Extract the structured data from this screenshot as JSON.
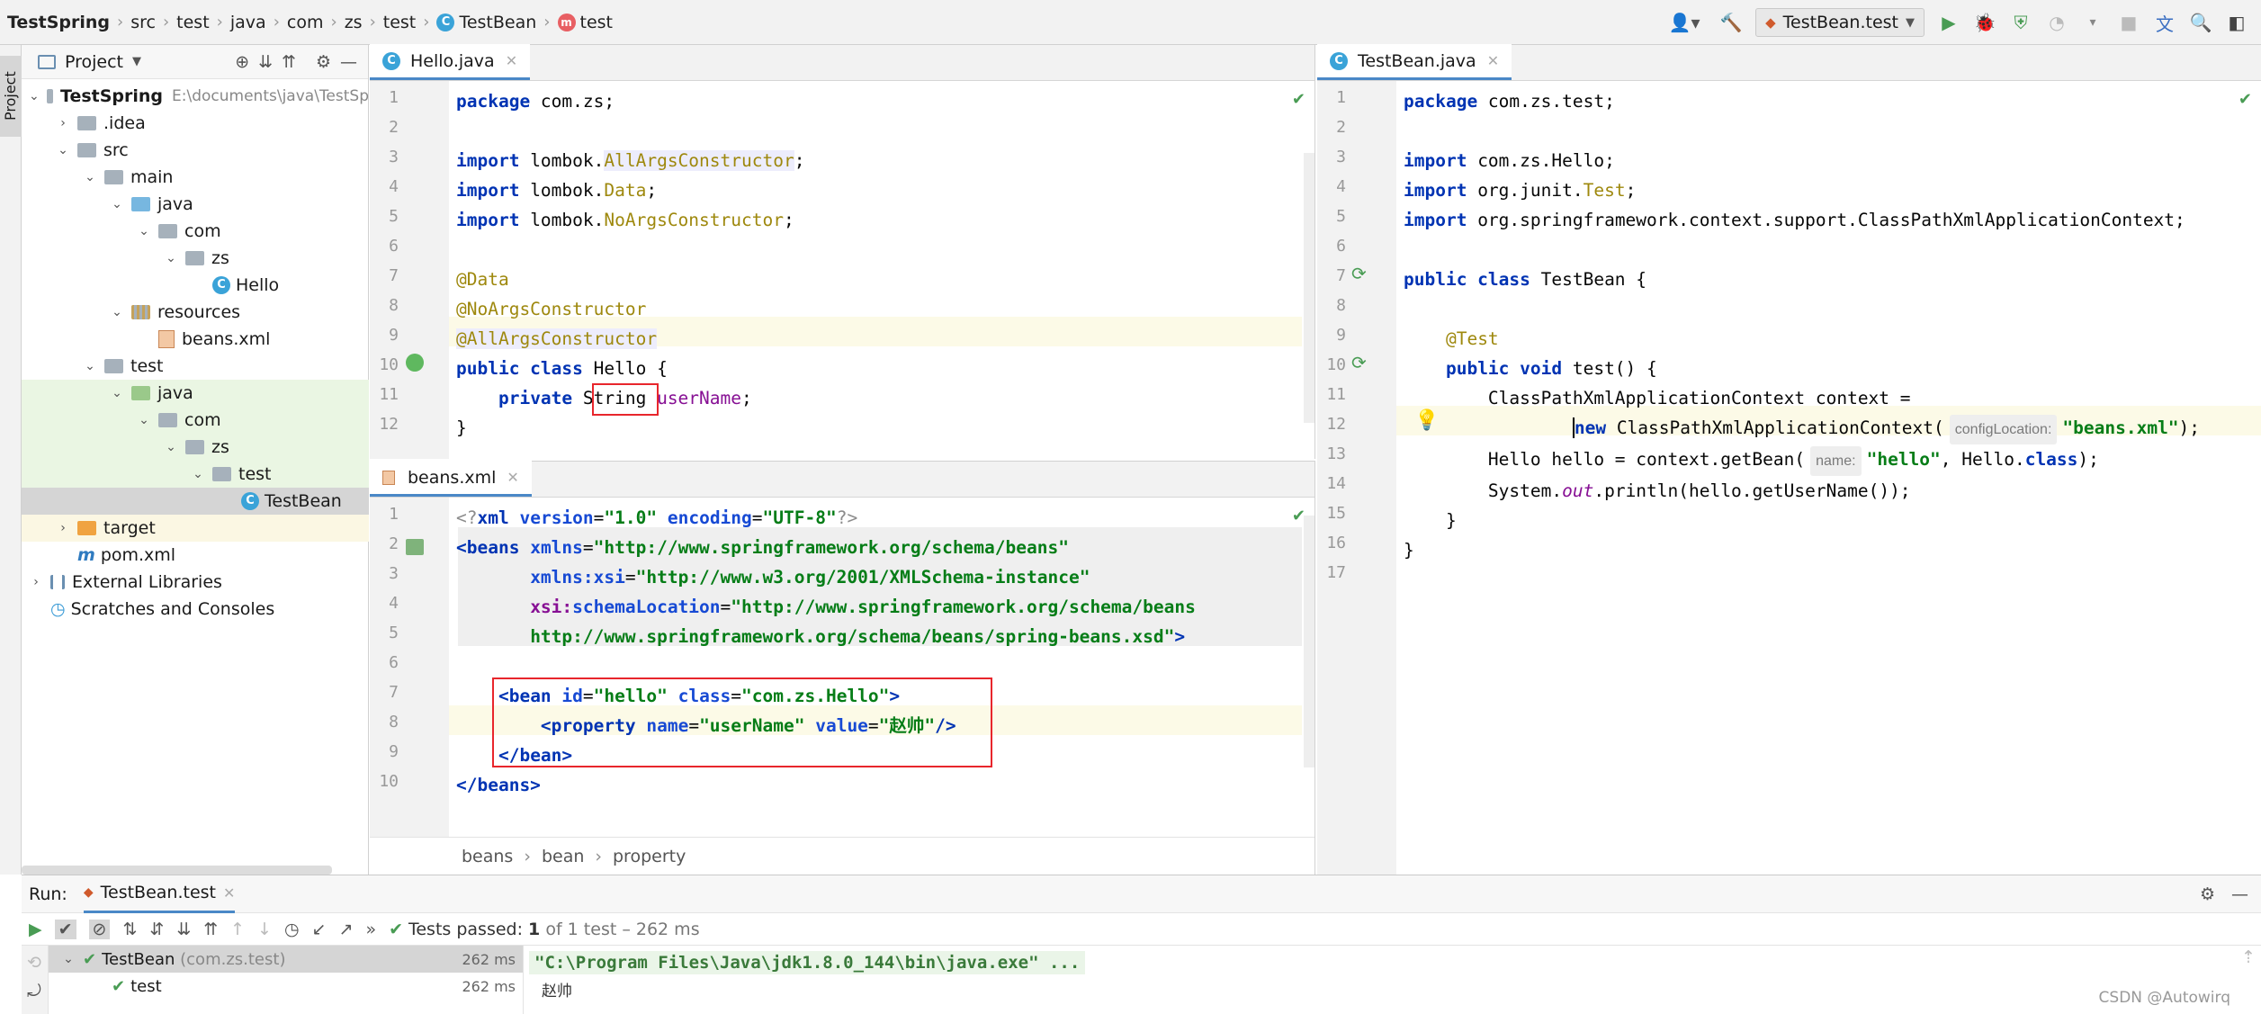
{
  "breadcrumb": [
    "TestSpring",
    "src",
    "test",
    "java",
    "com",
    "zs",
    "test",
    "TestBean",
    "test"
  ],
  "toolbar": {
    "run_config": "TestBean.test"
  },
  "sidebar_strip": {
    "label": "Project"
  },
  "project": {
    "title": "Project",
    "tree": [
      {
        "label": "TestSpring",
        "path": "E:\\documents\\java\\TestSp"
      },
      {
        "label": ".idea"
      },
      {
        "label": "src"
      },
      {
        "label": "main"
      },
      {
        "label": "java"
      },
      {
        "label": "com"
      },
      {
        "label": "zs"
      },
      {
        "label": "Hello"
      },
      {
        "label": "resources"
      },
      {
        "label": "beans.xml"
      },
      {
        "label": "test"
      },
      {
        "label": "java"
      },
      {
        "label": "com"
      },
      {
        "label": "zs"
      },
      {
        "label": "test"
      },
      {
        "label": "TestBean"
      },
      {
        "label": "target"
      },
      {
        "label": "pom.xml"
      },
      {
        "label": "External Libraries"
      },
      {
        "label": "Scratches and Consoles"
      }
    ]
  },
  "editor_hello": {
    "tab": "Hello.java",
    "lines": [
      "package com.zs;",
      "",
      "import lombok.AllArgsConstructor;",
      "import lombok.Data;",
      "import lombok.NoArgsConstructor;",
      "",
      "@Data",
      "@NoArgsConstructor",
      "@AllArgsConstructor",
      "public class Hello {",
      "    private String userName;",
      "}"
    ]
  },
  "editor_beans": {
    "tab": "beans.xml",
    "lines": [
      "<?xml version=\"1.0\" encoding=\"UTF-8\"?>",
      "<beans xmlns=\"http://www.springframework.org/schema/beans\"",
      "       xmlns:xsi=\"http://www.w3.org/2001/XMLSchema-instance\"",
      "       xsi:schemaLocation=\"http://www.springframework.org/schema/beans",
      "       http://www.springframework.org/schema/beans/spring-beans.xsd\">",
      "",
      "    <bean id=\"hello\" class=\"com.zs.Hello\">",
      "        <property name=\"userName\" value=\"赵帅\"/>",
      "    </bean>",
      "</beans>"
    ],
    "breadcrumb": [
      "beans",
      "bean",
      "property"
    ]
  },
  "editor_testbean": {
    "tab": "TestBean.java",
    "lines": [
      "package com.zs.test;",
      "",
      "import com.zs.Hello;",
      "import org.junit.Test;",
      "import org.springframework.context.support.ClassPathXmlApplicationContext;",
      "",
      "public class TestBean {",
      "",
      "    @Test",
      "    public void test() {",
      "        ClassPathXmlApplicationContext context =",
      "                new ClassPathXmlApplicationContext( configLocation: \"beans.xml\");",
      "        Hello hello = context.getBean( name: \"hello\", Hello.class);",
      "        System.out.println(hello.getUserName());",
      "    }",
      "}",
      ""
    ]
  },
  "run": {
    "label": "Run:",
    "tab": "TestBean.test",
    "status_prefix": "Tests passed:",
    "status_count": "1",
    "status_rest": "of 1 test – 262 ms",
    "tree": [
      {
        "name": "TestBean",
        "pkg": "(com.zs.test)",
        "time": "262 ms"
      },
      {
        "name": "test",
        "time": "262 ms"
      }
    ],
    "console": [
      "\"C:\\Program Files\\Java\\jdk1.8.0_144\\bin\\java.exe\" ...",
      "赵帅"
    ]
  },
  "watermark": "CSDN @Autowirq"
}
